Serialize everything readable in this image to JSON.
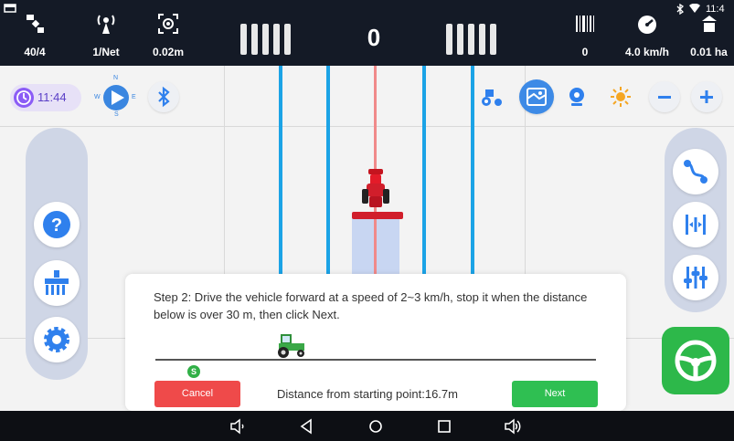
{
  "status_bar": {
    "satellites": {
      "icon": "satellite-icon",
      "value": "40/4"
    },
    "network": {
      "icon": "antenna-icon",
      "value": "1/Net"
    },
    "precision": {
      "icon": "gps-target-icon",
      "value": "0.02m"
    },
    "lightbar": {
      "value": "0"
    },
    "counter": {
      "icon": "barcode-icon",
      "value": "0"
    },
    "speed": {
      "icon": "speedometer-icon",
      "value": "4.0 km/h"
    },
    "area": {
      "icon": "field-area-icon",
      "value": "0.01 ha"
    },
    "system_time": "11:4"
  },
  "map": {
    "time_label": "11:44",
    "compass": {
      "north": "N",
      "south": "S",
      "west": "W",
      "east": "E"
    }
  },
  "dialog": {
    "instruction": "Step 2: Drive the vehicle forward at a speed of 2~3 km/h, stop it when the distance below is over 30 m, then click Next.",
    "start_marker": "S",
    "progress": 0.3,
    "cancel_label": "Cancel",
    "distance_text": "Distance from starting point:16.7m",
    "next_label": "Next"
  },
  "colors": {
    "accent_blue": "#1ba3e6",
    "tractor_red": "#d11e2b",
    "cancel_red": "#ef4a4a",
    "next_green": "#2fbf52",
    "steer_green": "#2db84a",
    "topbar_bg": "#141a26"
  }
}
